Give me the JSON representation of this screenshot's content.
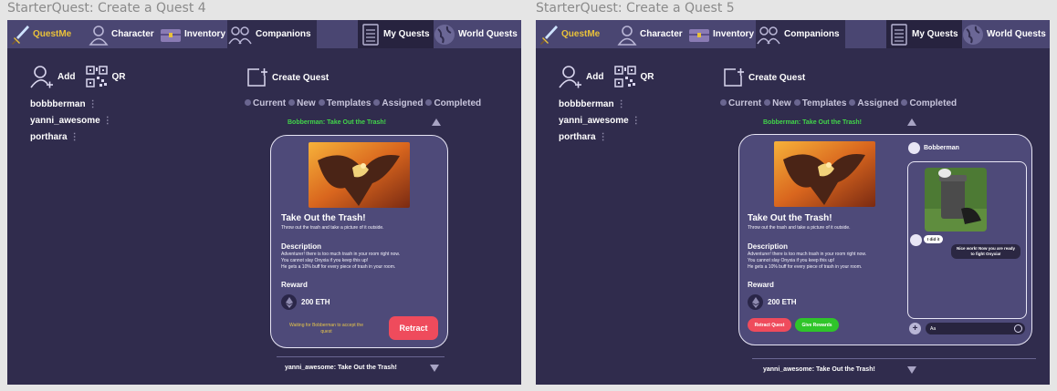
{
  "frames": [
    {
      "title": "StarterQuest: Create a Quest 4",
      "nav": {
        "questme": "QuestMe",
        "character": "Character",
        "inventory": "Inventory",
        "companions": "Companions",
        "my_quests": "My Quests",
        "world_quests": "World Quests"
      },
      "add_label": "Add",
      "qr_label": "QR",
      "contacts": [
        "bobbberman",
        "yanni_awesome",
        "porthara"
      ],
      "create_quest": "Create Quest",
      "filters": [
        "Current",
        "New",
        "Templates",
        "Assigned",
        "Completed"
      ],
      "active_quest_title": "Bobberman: Take Out the Trash!",
      "quest": {
        "title": "Take Out the Trash!",
        "subtitle": "Throw out the trash and take a picture of it outside.",
        "description_header": "Description",
        "description_lines": [
          "Adventurer! there is too much trash in your room right now.",
          "You cannot slay Onyxia if you keep this up!",
          "He gets a 10% buff for every piece of trash in your room."
        ],
        "reward_header": "Reward",
        "reward_value": "200 ETH"
      },
      "waiting_text": "Waiting for Bobberman to accept the quest",
      "retract_label": "Retract",
      "bottom_quest_title": "yanni_awesome: Take Out the Trash!"
    },
    {
      "title": "StarterQuest: Create a Quest 5",
      "nav": {
        "questme": "QuestMe",
        "character": "Character",
        "inventory": "Inventory",
        "companions": "Companions",
        "my_quests": "My Quests",
        "world_quests": "World Quests"
      },
      "add_label": "Add",
      "qr_label": "QR",
      "contacts": [
        "bobbberman",
        "yanni_awesome",
        "porthara"
      ],
      "create_quest": "Create Quest",
      "filters": [
        "Current",
        "New",
        "Templates",
        "Assigned",
        "Completed"
      ],
      "active_quest_title": "Bobberman: Take Out the Trash!",
      "quest": {
        "title": "Take Out the Trash!",
        "subtitle": "Throw out the trash and take a picture of it outside.",
        "description_header": "Description",
        "description_lines": [
          "Adventurer! there is too much trash in your room right now.",
          "You cannot slay Onyxia if you keep this up!",
          "He gets a 10% buff for every piece of trash in your room."
        ],
        "reward_header": "Reward",
        "reward_value": "200 ETH"
      },
      "retract_quest_label": "Retract Quest",
      "give_rewards_label": "Give Rewards",
      "chat": {
        "user": "Bobberman",
        "msg_me": "I did it",
        "msg_them": "Nice work! Now you are ready to fight Onyxia!",
        "input_value": "Aa"
      },
      "bottom_quest_title": "yanni_awesome: Take Out the Trash!"
    }
  ],
  "colors": {
    "frame_bg": "#302c4d",
    "topbar_bg": "#4a4672",
    "card_bg": "#4e4a79",
    "green_title": "#42d64a",
    "retract_red": "#ef4b5c",
    "give_rewards_green": "#2fc52a",
    "gold": "#e9c13a"
  }
}
